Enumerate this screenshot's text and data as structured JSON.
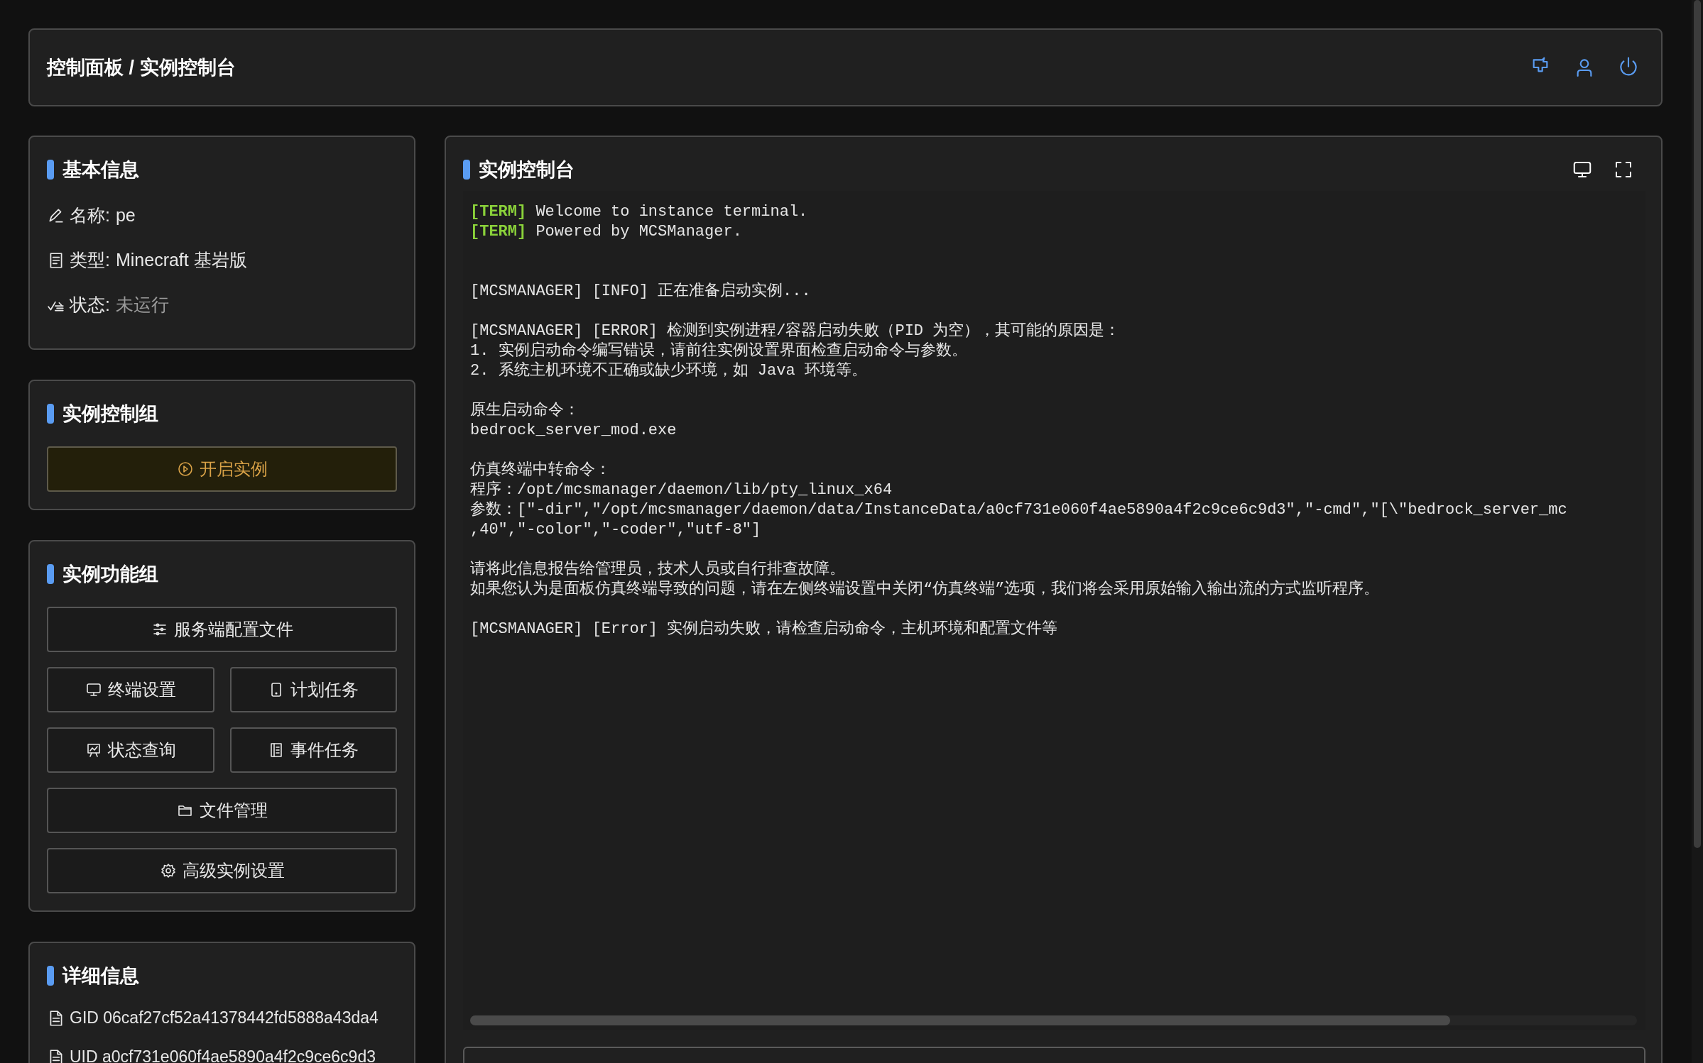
{
  "header": {
    "title": "控制面板 / 实例控制台",
    "icons": [
      {
        "kind": "clean"
      },
      {
        "kind": "user"
      },
      {
        "kind": "power"
      }
    ]
  },
  "basic_info": {
    "title": "基本信息",
    "rows": [
      {
        "kind": "name",
        "label": "名称:",
        "value": "pe"
      },
      {
        "kind": "type",
        "label": "类型:",
        "value": "Minecraft 基岩版"
      },
      {
        "kind": "status",
        "label": "状态:",
        "value": "未运行"
      }
    ]
  },
  "control_group": {
    "title": "实例控制组",
    "buttons": [
      {
        "kind": "start",
        "label": "开启实例"
      }
    ]
  },
  "function_group": {
    "title": "实例功能组",
    "buttons": [
      {
        "kind": "sliders",
        "wide": true,
        "label": "服务端配置文件"
      },
      {
        "kind": "monitor",
        "wide": false,
        "label": "终端设置"
      },
      {
        "kind": "tablet",
        "wide": false,
        "label": "计划任务"
      },
      {
        "kind": "chart",
        "wide": false,
        "label": "状态查询"
      },
      {
        "kind": "list",
        "wide": false,
        "label": "事件任务"
      },
      {
        "kind": "folder",
        "wide": true,
        "label": "文件管理"
      },
      {
        "kind": "gear",
        "wide": true,
        "label": "高级实例设置"
      }
    ]
  },
  "details": {
    "title": "详细信息",
    "rows": [
      {
        "label": "GID",
        "value": "06caf27cf52a41378442fd5888a43da4"
      },
      {
        "label": "UID",
        "value": "a0cf731e060f4ae5890a4f2c9ce6c9d3"
      }
    ]
  },
  "console": {
    "title": "实例控制台",
    "icons": [
      {
        "kind": "monitor"
      },
      {
        "kind": "fullscreen"
      }
    ],
    "blocks": [
      {
        "lines": [
          {
            "tag": "[TERM]",
            "text": "Welcome to instance terminal."
          },
          {
            "tag": "[TERM]",
            "text": "Powered by MCSManager."
          }
        ]
      },
      {
        "lines": [
          {
            "text": "[MCSMANAGER] [INFO] 正在准备启动实例..."
          }
        ]
      },
      {
        "lines": [
          {
            "text": "[MCSMANAGER] [ERROR] 检测到实例进程/容器启动失败（PID 为空），其可能的原因是："
          },
          {
            "text": "1. 实例启动命令编写错误，请前往实例设置界面检查启动命令与参数。"
          },
          {
            "text": "2. 系统主机环境不正确或缺少环境，如 Java 环境等。"
          }
        ]
      },
      {
        "lines": [
          {
            "text": "原生启动命令："
          },
          {
            "text": "bedrock_server_mod.exe"
          }
        ]
      },
      {
        "lines": [
          {
            "text": "仿真终端中转命令："
          },
          {
            "text": "程序：/opt/mcsmanager/daemon/lib/pty_linux_x64"
          },
          {
            "text": "参数：[\"-dir\",\"/opt/mcsmanager/daemon/data/InstanceData/a0cf731e060f4ae5890a4f2c9ce6c9d3\",\"-cmd\",\"[\\\"bedrock_server_mc"
          },
          {
            "text": ",40\",\"-color\",\"-coder\",\"utf-8\"]"
          }
        ]
      },
      {
        "lines": [
          {
            "text": "请将此信息报告给管理员，技术人员或自行排查故障。"
          },
          {
            "text": "如果您认为是面板仿真终端导致的问题，请在左侧终端设置中关闭“仿真终端”选项，我们将会采用原始输入输出流的方式监听程序。"
          }
        ]
      },
      {
        "lines": [
          {
            "text": "[MCSMANAGER] [Error] 实例启动失败，请检查启动命令，主机环境和配置文件等"
          }
        ]
      }
    ]
  }
}
